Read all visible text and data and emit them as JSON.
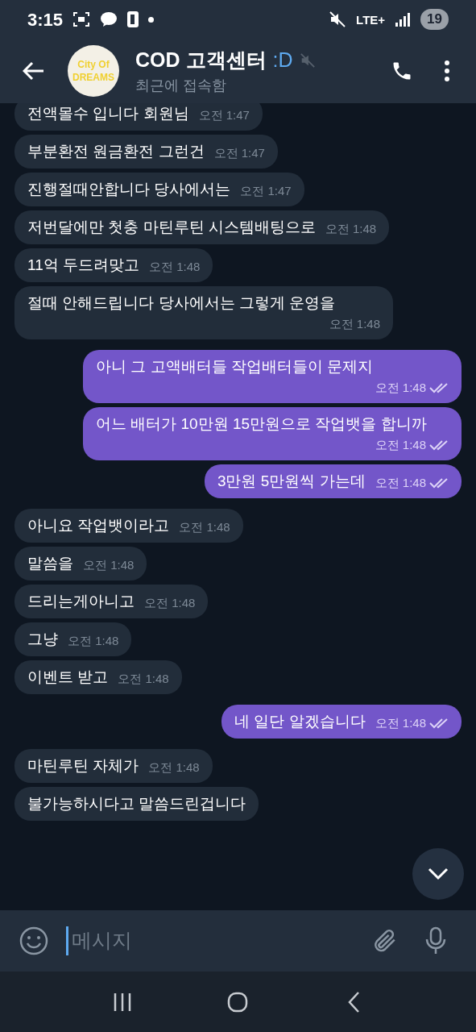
{
  "status_bar": {
    "time": "3:15",
    "network": "LTE+",
    "battery": "19"
  },
  "header": {
    "title": "COD 고객센터",
    "title_suffix": ":D",
    "muted": true,
    "subtitle": "최근에 접속함",
    "avatar_lines": [
      "City Of",
      "DREAMS"
    ]
  },
  "messages": [
    {
      "kind": "in",
      "text": "전액몰수 입니다 회원님",
      "time": "오전 1:47"
    },
    {
      "kind": "in",
      "text": "부분환전 원금환전 그런건",
      "time": "오전 1:47"
    },
    {
      "kind": "in",
      "text": "진행절때안합니다 당사에서는",
      "time": "오전 1:47"
    },
    {
      "kind": "in",
      "text": "저번달에만 첫충 마틴루틴 시스템배팅으로",
      "time": "오전 1:48"
    },
    {
      "kind": "in",
      "text": "11억 두드려맞고",
      "time": "오전 1:48"
    },
    {
      "kind": "in",
      "text": "절때 안해드립니다 당사에서는 그렇게 운영을",
      "time": "오전 1:48"
    },
    {
      "kind": "out",
      "text": "아니 그 고액배터들 작업배터들이 문제지",
      "time": "오전 1:48",
      "read": true
    },
    {
      "kind": "out",
      "text": "어느 배터가 10만원 15만원으로 작업뱃을 합니까",
      "time": "오전 1:48",
      "read": true
    },
    {
      "kind": "out",
      "text": "3만원 5만원씩 가는데",
      "time": "오전 1:48",
      "read": true
    },
    {
      "kind": "in",
      "text": "아니요 작업뱃이라고",
      "time": "오전 1:48"
    },
    {
      "kind": "in",
      "text": "말씀을",
      "time": "오전 1:48"
    },
    {
      "kind": "in",
      "text": "드리는게아니고",
      "time": "오전 1:48"
    },
    {
      "kind": "in",
      "text": "그냥",
      "time": "오전 1:48"
    },
    {
      "kind": "in",
      "text": "이벤트 받고",
      "time": "오전 1:48"
    },
    {
      "kind": "out",
      "text": "네 일단 알겠습니다",
      "time": "오전 1:48",
      "read": true
    },
    {
      "kind": "in",
      "text": "마틴루틴 자체가",
      "time": "오전 1:48"
    },
    {
      "kind": "in",
      "text": "불가능하시다고 말씀드린겁니다"
    }
  ],
  "composer": {
    "placeholder": "메시지"
  }
}
